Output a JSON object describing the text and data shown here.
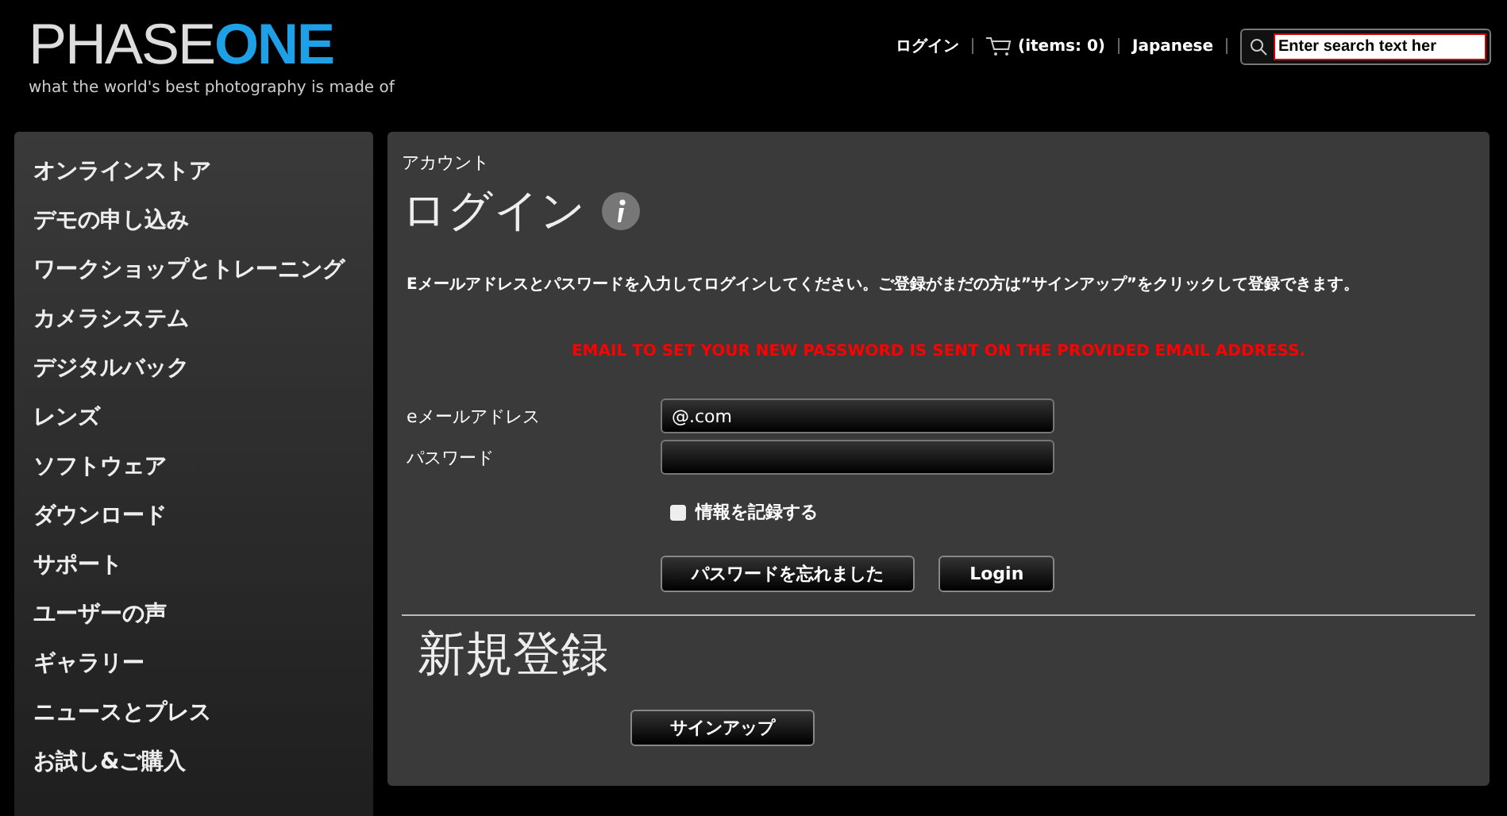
{
  "logo": {
    "word_1": "PHASE",
    "word_2": "ONE",
    "tagline": "what the world's best photography is made of"
  },
  "top_nav": {
    "login": "ログイン",
    "cart": "(items: 0)",
    "language": "Japanese",
    "search": {
      "placeholder": "Enter search text her"
    }
  },
  "sidebar": {
    "items": [
      {
        "label": "オンラインストア"
      },
      {
        "label": "デモの申し込み"
      },
      {
        "label": "ワークショップとトレーニング"
      },
      {
        "label": "カメラシステム"
      },
      {
        "label": "デジタルバック"
      },
      {
        "label": "レンズ"
      },
      {
        "label": "ソフトウェア"
      },
      {
        "label": "ダウンロード"
      },
      {
        "label": "サポート"
      },
      {
        "label": "ユーザーの声"
      },
      {
        "label": "ギャラリー"
      },
      {
        "label": "ニュースとプレス"
      },
      {
        "label": "お試し&ご購入"
      }
    ]
  },
  "content": {
    "breadcrumb": "アカウント",
    "title": "ログイン",
    "intro": "Eメールアドレスとパスワードを入力してログインしてください。ご登録がまだの方は”サインアップ”をクリックして登録できます。",
    "notice": "EMAIL TO SET YOUR NEW PASSWORD IS SENT ON THE PROVIDED EMAIL ADDRESS.",
    "fields": [
      {
        "label": "eメールアドレス",
        "value": "@.com"
      },
      {
        "label": "パスワード"
      }
    ],
    "remember": {
      "label": "情報を記録する",
      "checked": false
    },
    "buttons": [
      "パスワードを忘れました",
      "Login"
    ],
    "signup_title": "新規登録",
    "signup_button": "サインアップ"
  }
}
